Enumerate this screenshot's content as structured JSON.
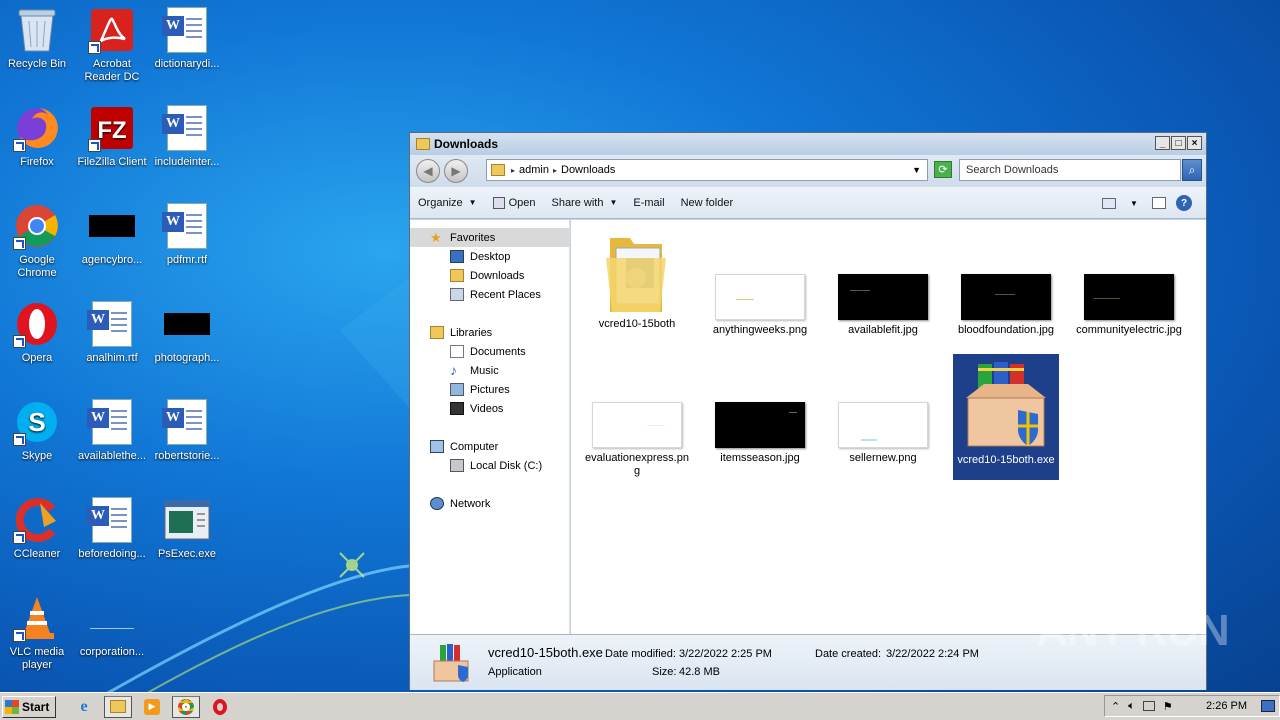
{
  "desktop": {
    "icons": [
      {
        "label": "Recycle Bin"
      },
      {
        "label": "Acrobat Reader DC"
      },
      {
        "label": "dictionarydi..."
      },
      {
        "label": "Firefox"
      },
      {
        "label": "FileZilla Client"
      },
      {
        "label": "includeinter..."
      },
      {
        "label": "Google Chrome"
      },
      {
        "label": "agencybro..."
      },
      {
        "label": "pdfmr.rtf"
      },
      {
        "label": "Opera"
      },
      {
        "label": "analhim.rtf"
      },
      {
        "label": "photograph..."
      },
      {
        "label": "Skype"
      },
      {
        "label": "availablethe..."
      },
      {
        "label": "robertstorie..."
      },
      {
        "label": "CCleaner"
      },
      {
        "label": "beforedoing..."
      },
      {
        "label": "PsExec.exe"
      },
      {
        "label": "VLC media player"
      },
      {
        "label": "corporation..."
      }
    ]
  },
  "window": {
    "title": "Downloads",
    "address": {
      "crumbs": [
        "admin",
        "Downloads"
      ]
    },
    "search_placeholder": "Search Downloads",
    "toolbar": {
      "organize": "Organize",
      "open": "Open",
      "share_with": "Share with",
      "email": "E-mail",
      "new_folder": "New folder"
    },
    "nav": {
      "favorites": "Favorites",
      "desktop": "Desktop",
      "downloads": "Downloads",
      "recent_places": "Recent Places",
      "libraries": "Libraries",
      "documents": "Documents",
      "music": "Music",
      "pictures": "Pictures",
      "videos": "Videos",
      "computer": "Computer",
      "local_disk": "Local Disk (C:)",
      "network": "Network"
    },
    "files": [
      {
        "name": "vcred10-15both"
      },
      {
        "name": "anythingweeks.png"
      },
      {
        "name": "availablefit.jpg"
      },
      {
        "name": "bloodfoundation.jpg"
      },
      {
        "name": "communityelectric.jpg"
      },
      {
        "name": "evaluationexpress.png"
      },
      {
        "name": "itemsseason.jpg"
      },
      {
        "name": "sellernew.png"
      },
      {
        "name": "vcred10-15both.exe"
      }
    ],
    "details": {
      "filename": "vcred10-15both.exe",
      "type": "Application",
      "date_modified_label": "Date modified:",
      "date_modified": "3/22/2022 2:25 PM",
      "size_label": "Size:",
      "size": "42.8 MB",
      "date_created_label": "Date created:",
      "date_created": "3/22/2022 2:24 PM"
    }
  },
  "taskbar": {
    "start": "Start",
    "clock": "2:26 PM"
  },
  "watermark": "ANY RUN"
}
